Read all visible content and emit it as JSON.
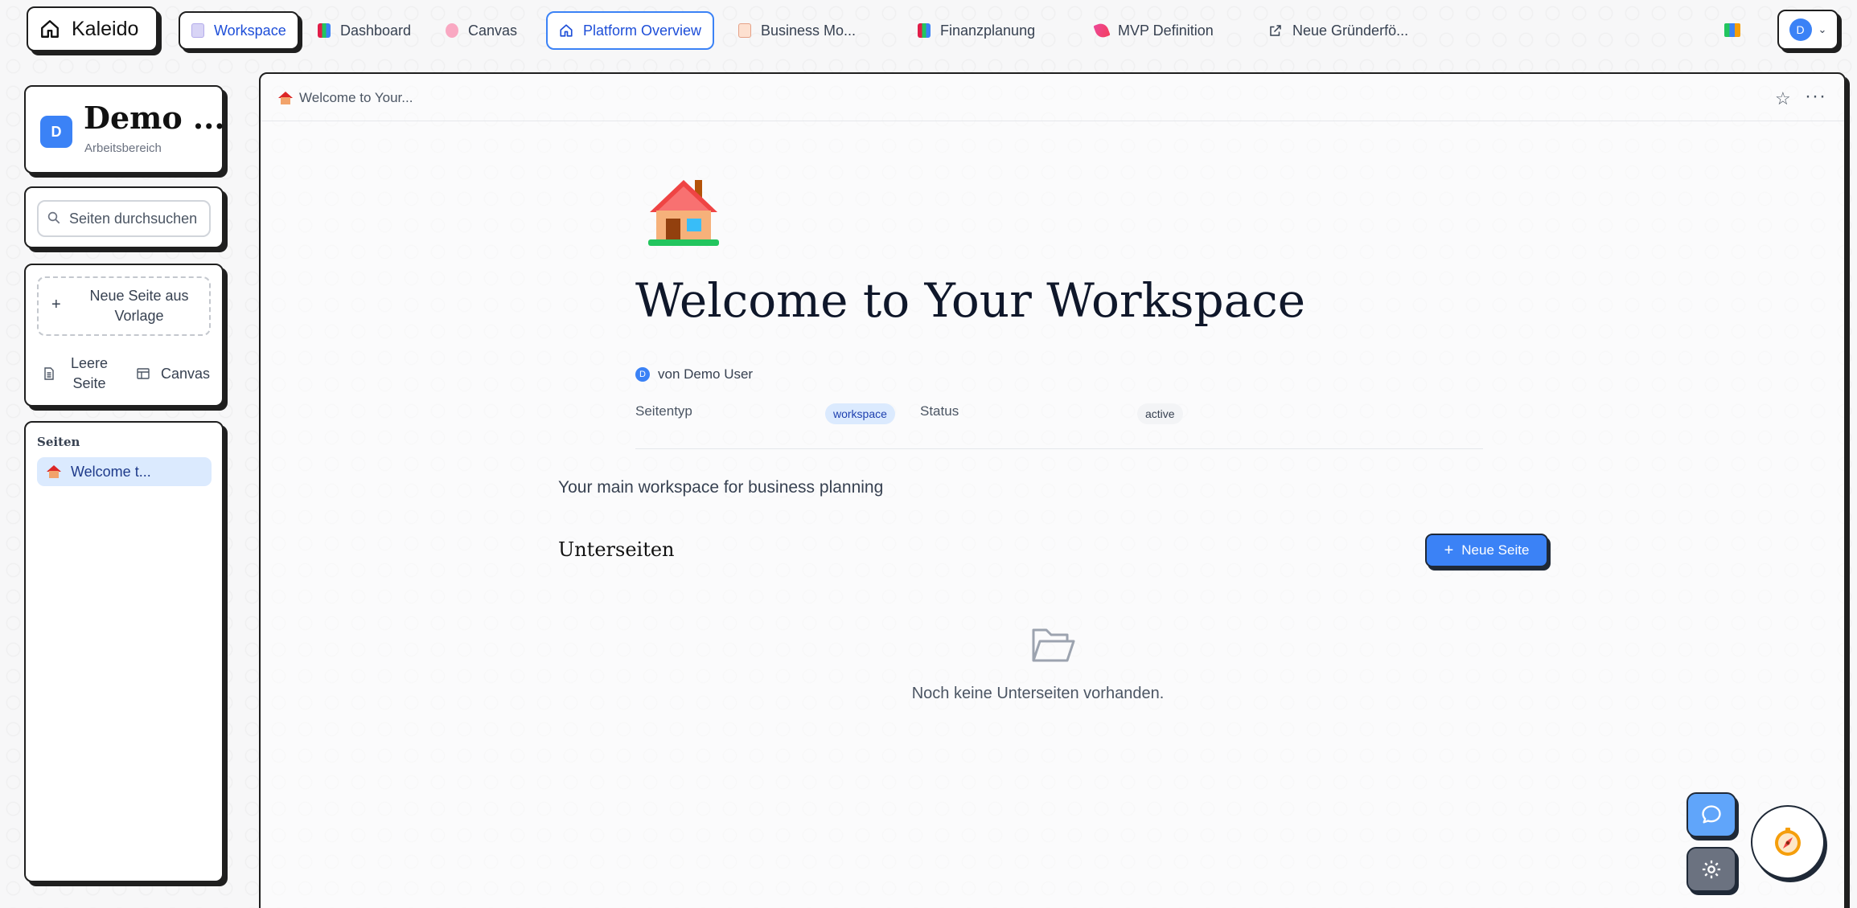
{
  "brand": {
    "name": "Kaleido",
    "icon": "home-icon"
  },
  "tabs": [
    {
      "label": "Workspace",
      "icon": "document-icon"
    },
    {
      "label": "Dashboard",
      "icon": "bar-chart-icon"
    },
    {
      "label": "Canvas",
      "icon": "brain-icon"
    },
    {
      "label": "Platform Overview",
      "icon": "home-icon"
    },
    {
      "label": "Business Mo...",
      "icon": "ledger-icon"
    },
    {
      "label": "Finanzplanung",
      "icon": "bar-chart-icon"
    },
    {
      "label": "MVP Definition",
      "icon": "rocket-icon"
    },
    {
      "label": "Neue Gründerfö...",
      "icon": "external-link-icon"
    }
  ],
  "user": {
    "initial": "D"
  },
  "sidebar": {
    "workspace_initial": "D",
    "workspace_name": "Demo ...",
    "workspace_sub": "Arbeitsbereich",
    "search_placeholder": "Seiten durchsuchen",
    "template_label": "Neue Seite aus Vorlage",
    "empty_page_label": "Leere Seite",
    "canvas_label": "Canvas",
    "pages_heading": "Seiten",
    "pages": [
      {
        "label": "Welcome t...",
        "icon": "house-icon"
      }
    ]
  },
  "page": {
    "breadcrumb": "Welcome to Your...",
    "title": "Welcome to Your Workspace",
    "author": "von Demo User",
    "author_initial": "D",
    "type_label": "Seitentyp",
    "type_value": "workspace",
    "status_label": "Status",
    "status_value": "active",
    "description": "Your main workspace for business planning",
    "subpages_heading": "Unterseiten",
    "new_page_button": "Neue Seite",
    "empty_message": "Noch keine Unterseiten vorhanden."
  },
  "colors": {
    "accent": "#3b82f6",
    "border": "#1f1f1f",
    "chip_bg": "#dbeafe"
  }
}
